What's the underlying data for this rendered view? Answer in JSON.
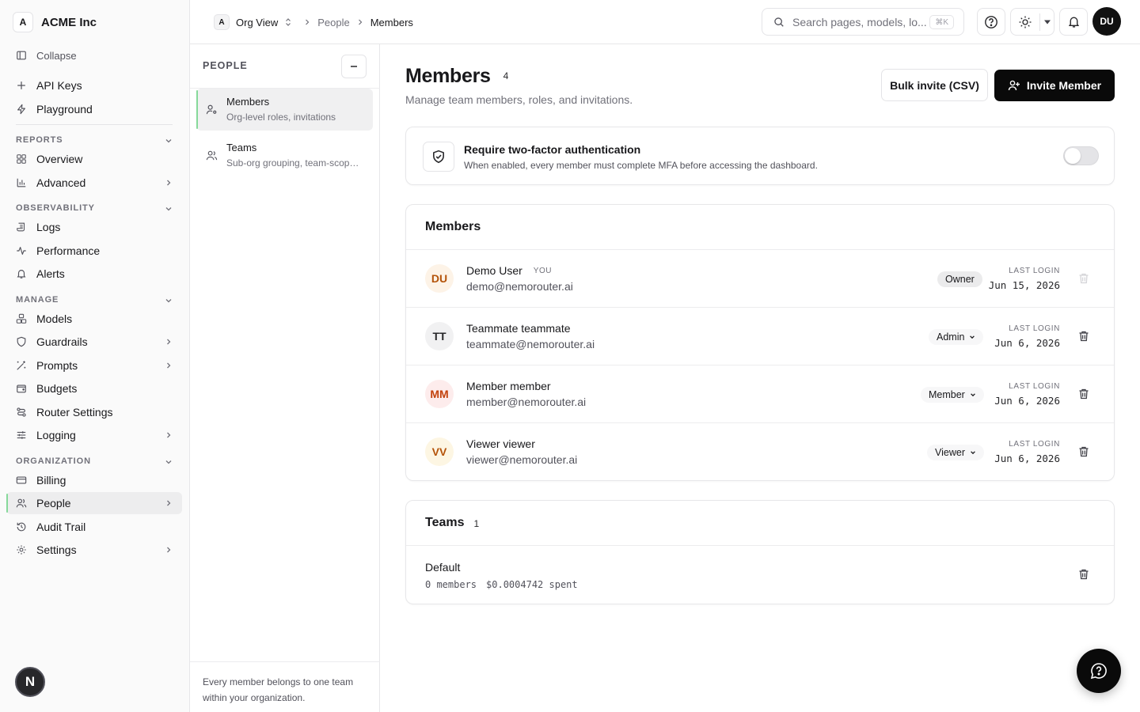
{
  "org": {
    "badge": "A",
    "name": "ACME Inc"
  },
  "sidebar": {
    "collapse_label": "Collapse",
    "top_items": [
      {
        "label": "API Keys",
        "icon": "plus-icon"
      },
      {
        "label": "Playground",
        "icon": "lightning-icon"
      }
    ],
    "sections": [
      {
        "title": "REPORTS",
        "items": [
          {
            "label": "Overview"
          },
          {
            "label": "Advanced"
          }
        ]
      },
      {
        "title": "OBSERVABILITY",
        "items": [
          {
            "label": "Logs"
          },
          {
            "label": "Performance"
          },
          {
            "label": "Alerts"
          }
        ]
      },
      {
        "title": "MANAGE",
        "items": [
          {
            "label": "Models"
          },
          {
            "label": "Guardrails"
          },
          {
            "label": "Prompts"
          },
          {
            "label": "Budgets"
          },
          {
            "label": "Router Settings"
          },
          {
            "label": "Logging"
          }
        ]
      },
      {
        "title": "ORGANIZATION",
        "items": [
          {
            "label": "Billing"
          },
          {
            "label": "People"
          },
          {
            "label": "Audit Trail"
          },
          {
            "label": "Settings"
          }
        ]
      }
    ],
    "bottom_badge": "N"
  },
  "topbar": {
    "breadcrumb": {
      "badge": "A",
      "org_view": "Org View",
      "people": "People",
      "current": "Members"
    },
    "search_placeholder": "Search pages, models, lo...",
    "search_shortcut": "⌘K",
    "avatar": "DU"
  },
  "subpanel": {
    "title": "PEOPLE",
    "items": [
      {
        "title": "Members",
        "subtitle": "Org-level roles, invitations"
      },
      {
        "title": "Teams",
        "subtitle": "Sub-org grouping, team-scoped budgets"
      }
    ],
    "footer": "Every member belongs to one team within your organization."
  },
  "main": {
    "title": "Members",
    "count": "4",
    "subtitle": "Manage team members, roles, and invitations.",
    "bulk_invite_label": "Bulk invite (CSV)",
    "invite_label": "Invite Member",
    "mfa": {
      "title": "Require two-factor authentication",
      "description": "When enabled, every member must complete MFA before accessing the dashboard.",
      "enabled": false
    },
    "members_heading": "Members",
    "last_login_label": "LAST LOGIN",
    "members": [
      {
        "initials": "DU",
        "name": "Demo User",
        "you_tag": "YOU",
        "email": "demo@nemorouter.ai",
        "role": "Owner",
        "last_login": "Jun 15, 2026",
        "avatar_bg": "#fdf3e7",
        "avatar_fg": "#b45309"
      },
      {
        "initials": "TT",
        "name": "Teammate teammate",
        "you_tag": "",
        "email": "teammate@nemorouter.ai",
        "role": "Admin",
        "last_login": "Jun 6, 2026",
        "avatar_bg": "#f1f1f2",
        "avatar_fg": "#27272a"
      },
      {
        "initials": "MM",
        "name": "Member member",
        "you_tag": "",
        "email": "member@nemorouter.ai",
        "role": "Member",
        "last_login": "Jun 6, 2026",
        "avatar_bg": "#fdecec",
        "avatar_fg": "#c2410c"
      },
      {
        "initials": "VV",
        "name": "Viewer viewer",
        "you_tag": "",
        "email": "viewer@nemorouter.ai",
        "role": "Viewer",
        "last_login": "Jun 6, 2026",
        "avatar_bg": "#fdf6e3",
        "avatar_fg": "#b45309"
      }
    ],
    "teams_heading": "Teams",
    "teams_count": "1",
    "teams": [
      {
        "name": "Default",
        "members": "0 members",
        "spent": "$0.0004742 spent"
      }
    ]
  }
}
